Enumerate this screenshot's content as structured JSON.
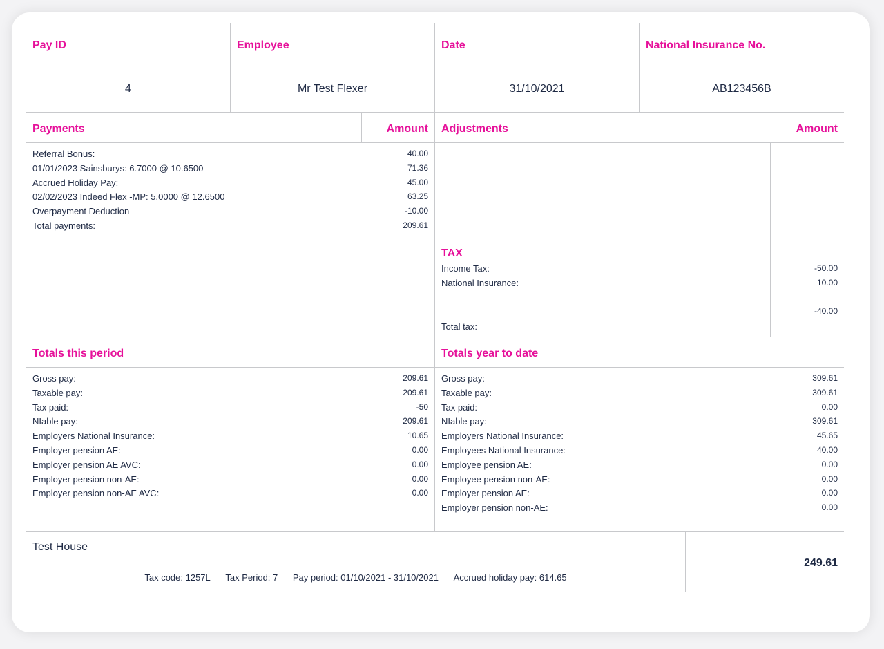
{
  "header": {
    "labels": [
      "Pay ID",
      "Employee",
      "Date",
      "National Insurance No."
    ],
    "values": [
      "4",
      "Mr Test Flexer",
      "31/10/2021",
      "AB123456B"
    ]
  },
  "payments": {
    "title": "Payments",
    "amount_label": "Amount",
    "rows": [
      {
        "label": "Referral Bonus:",
        "value": "40.00"
      },
      {
        "label": "01/01/2023 Sainsburys: 6.7000 @ 10.6500",
        "value": "71.36"
      },
      {
        "label": "Accrued Holiday Pay:",
        "value": "45.00"
      },
      {
        "label": "02/02/2023 Indeed Flex -MP: 5.0000 @ 12.6500",
        "value": "63.25"
      },
      {
        "label": "Overpayment Deduction",
        "value": "-10.00"
      },
      {
        "label": "Total payments:",
        "value": "209.61"
      }
    ]
  },
  "adjustments": {
    "title": "Adjustments",
    "amount_label": "Amount",
    "tax_title": "TAX",
    "rows": [
      {
        "label": "Income Tax:",
        "value": "-50.00"
      },
      {
        "label": "National Insurance:",
        "value": "10.00"
      }
    ],
    "total_value": "-40.00",
    "total_label": "Total tax:"
  },
  "totals_period": {
    "title": "Totals this period",
    "rows": [
      {
        "label": "Gross pay:",
        "value": "209.61"
      },
      {
        "label": "Taxable pay:",
        "value": "209.61"
      },
      {
        "label": "Tax paid:",
        "value": "-50"
      },
      {
        "label": "NIable pay:",
        "value": "209.61"
      },
      {
        "label": "Employers National Insurance:",
        "value": "10.65"
      },
      {
        "label": "Employer pension AE:",
        "value": "0.00"
      },
      {
        "label": "Employer pension AE AVC:",
        "value": "0.00"
      },
      {
        "label": "Employer pension non-AE:",
        "value": "0.00"
      },
      {
        "label": "Employer pension non-AE AVC:",
        "value": "0.00"
      }
    ]
  },
  "totals_ytd": {
    "title": "Totals year to date",
    "rows": [
      {
        "label": "Gross pay:",
        "value": "309.61"
      },
      {
        "label": "Taxable pay:",
        "value": "309.61"
      },
      {
        "label": "Tax paid:",
        "value": "0.00"
      },
      {
        "label": "NIable pay:",
        "value": "309.61"
      },
      {
        "label": "Employers National Insurance:",
        "value": "45.65"
      },
      {
        "label": "Employees National Insurance:",
        "value": "40.00"
      },
      {
        "label": "Employee pension AE:",
        "value": "0.00"
      },
      {
        "label": "Employee pension non-AE:",
        "value": "0.00"
      },
      {
        "label": "Employer pension AE:",
        "value": "0.00"
      },
      {
        "label": "Employer pension non-AE:",
        "value": "0.00"
      }
    ]
  },
  "footer": {
    "company": "Test House",
    "tax_code": "Tax code: 1257L",
    "tax_period": "Tax Period: 7",
    "pay_period": "Pay period: 01/10/2021 - 31/10/2021",
    "accrued_holiday": "Accrued holiday pay: 614.65",
    "net_pay": "249.61"
  }
}
